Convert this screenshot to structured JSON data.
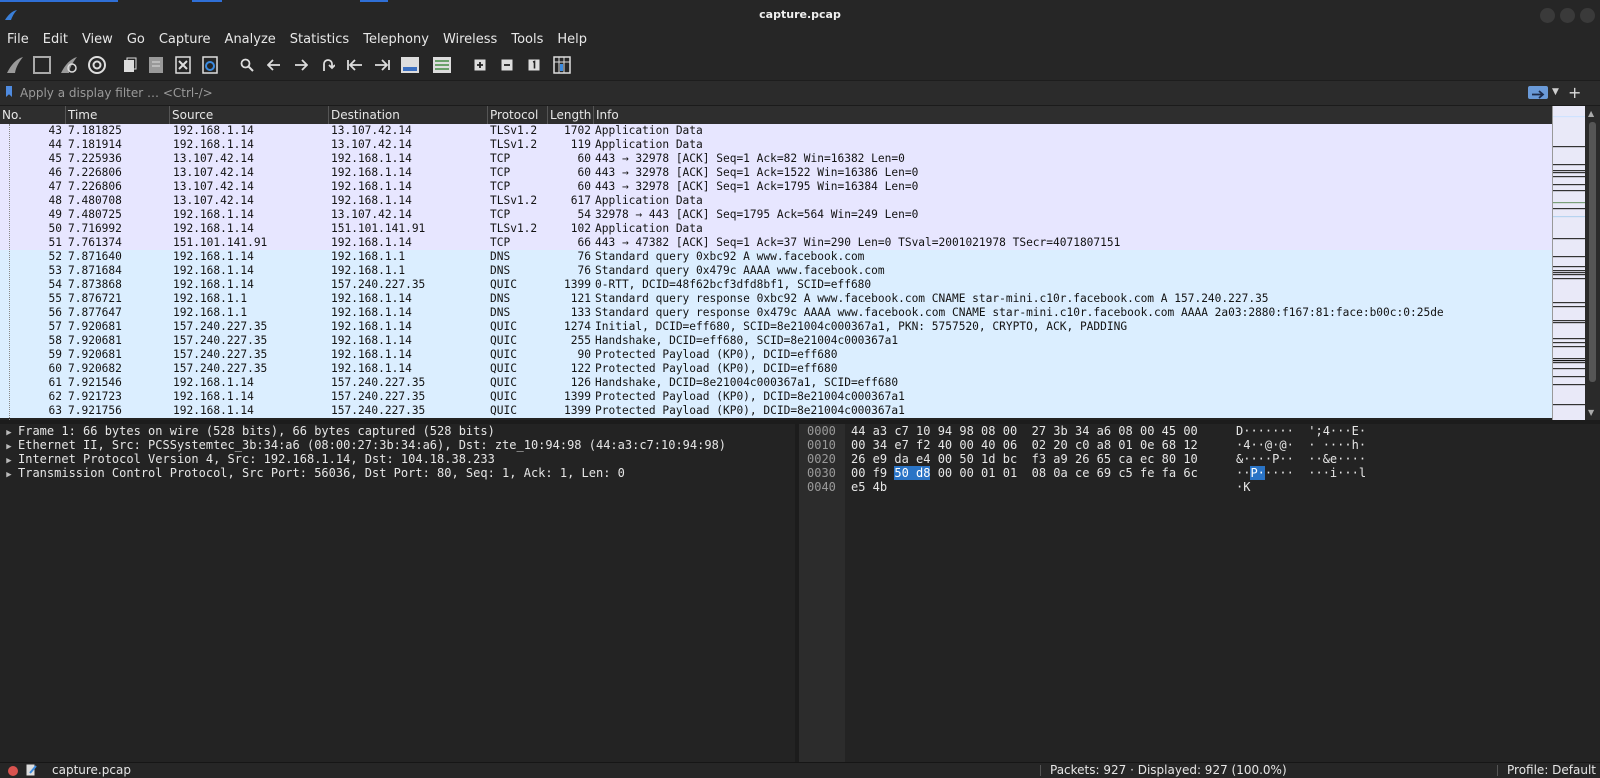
{
  "window": {
    "title": "capture.pcap"
  },
  "menu": [
    "File",
    "Edit",
    "View",
    "Go",
    "Capture",
    "Analyze",
    "Statistics",
    "Telephony",
    "Wireless",
    "Tools",
    "Help"
  ],
  "toolbar": {
    "icons": [
      "start-capture-icon",
      "stop-capture-icon",
      "restart-capture-icon",
      "capture-options-icon",
      "open-file-icon",
      "save-file-icon",
      "close-file-icon",
      "reload-file-icon",
      "find-packet-icon",
      "go-back-icon",
      "go-forward-icon",
      "go-to-packet-icon",
      "go-first-packet-icon",
      "go-last-packet-icon",
      "autoscroll-icon",
      "colorize-icon",
      "zoom-in-icon",
      "zoom-out-icon",
      "normal-size-icon",
      "resize-columns-icon"
    ]
  },
  "filter": {
    "placeholder": "Apply a display filter … <Ctrl-/>"
  },
  "columns": {
    "no": "No.",
    "time": "Time",
    "source": "Source",
    "destination": "Destination",
    "protocol": "Protocol",
    "length": "Length",
    "info": "Info"
  },
  "packets": [
    {
      "no": "43",
      "time": "7.181825",
      "src": "192.168.1.14",
      "dst": "13.107.42.14",
      "proto": "TLSv1.2",
      "len": "1702",
      "info": "Application Data",
      "kind": "tcp"
    },
    {
      "no": "44",
      "time": "7.181914",
      "src": "192.168.1.14",
      "dst": "13.107.42.14",
      "proto": "TLSv1.2",
      "len": "119",
      "info": "Application Data",
      "kind": "tcp"
    },
    {
      "no": "45",
      "time": "7.225936",
      "src": "13.107.42.14",
      "dst": "192.168.1.14",
      "proto": "TCP",
      "len": "60",
      "info": "443 → 32978 [ACK] Seq=1 Ack=82 Win=16382 Len=0",
      "kind": "tcp"
    },
    {
      "no": "46",
      "time": "7.226806",
      "src": "13.107.42.14",
      "dst": "192.168.1.14",
      "proto": "TCP",
      "len": "60",
      "info": "443 → 32978 [ACK] Seq=1 Ack=1522 Win=16386 Len=0",
      "kind": "tcp"
    },
    {
      "no": "47",
      "time": "7.226806",
      "src": "13.107.42.14",
      "dst": "192.168.1.14",
      "proto": "TCP",
      "len": "60",
      "info": "443 → 32978 [ACK] Seq=1 Ack=1795 Win=16384 Len=0",
      "kind": "tcp"
    },
    {
      "no": "48",
      "time": "7.480708",
      "src": "13.107.42.14",
      "dst": "192.168.1.14",
      "proto": "TLSv1.2",
      "len": "617",
      "info": "Application Data",
      "kind": "tcp"
    },
    {
      "no": "49",
      "time": "7.480725",
      "src": "192.168.1.14",
      "dst": "13.107.42.14",
      "proto": "TCP",
      "len": "54",
      "info": "32978 → 443 [ACK] Seq=1795 Ack=564 Win=249 Len=0",
      "kind": "tcp"
    },
    {
      "no": "50",
      "time": "7.716992",
      "src": "192.168.1.14",
      "dst": "151.101.141.91",
      "proto": "TLSv1.2",
      "len": "102",
      "info": "Application Data",
      "kind": "tcp"
    },
    {
      "no": "51",
      "time": "7.761374",
      "src": "151.101.141.91",
      "dst": "192.168.1.14",
      "proto": "TCP",
      "len": "66",
      "info": "443 → 47382 [ACK] Seq=1 Ack=37 Win=290 Len=0 TSval=2001021978 TSecr=4071807151",
      "kind": "tcp"
    },
    {
      "no": "52",
      "time": "7.871640",
      "src": "192.168.1.14",
      "dst": "192.168.1.1",
      "proto": "DNS",
      "len": "76",
      "info": "Standard query 0xbc92 A www.facebook.com",
      "kind": "udp"
    },
    {
      "no": "53",
      "time": "7.871684",
      "src": "192.168.1.14",
      "dst": "192.168.1.1",
      "proto": "DNS",
      "len": "76",
      "info": "Standard query 0x479c AAAA www.facebook.com",
      "kind": "udp"
    },
    {
      "no": "54",
      "time": "7.873868",
      "src": "192.168.1.14",
      "dst": "157.240.227.35",
      "proto": "QUIC",
      "len": "1399",
      "info": "0-RTT, DCID=48f62bcf3dfd8bf1, SCID=eff680",
      "kind": "udp"
    },
    {
      "no": "55",
      "time": "7.876721",
      "src": "192.168.1.1",
      "dst": "192.168.1.14",
      "proto": "DNS",
      "len": "121",
      "info": "Standard query response 0xbc92 A www.facebook.com CNAME star-mini.c10r.facebook.com A 157.240.227.35",
      "kind": "udp"
    },
    {
      "no": "56",
      "time": "7.877647",
      "src": "192.168.1.1",
      "dst": "192.168.1.14",
      "proto": "DNS",
      "len": "133",
      "info": "Standard query response 0x479c AAAA www.facebook.com CNAME star-mini.c10r.facebook.com AAAA 2a03:2880:f167:81:face:b00c:0:25de",
      "kind": "udp"
    },
    {
      "no": "57",
      "time": "7.920681",
      "src": "157.240.227.35",
      "dst": "192.168.1.14",
      "proto": "QUIC",
      "len": "1274",
      "info": "Initial, DCID=eff680, SCID=8e21004c000367a1, PKN: 5757520, CRYPTO, ACK, PADDING",
      "kind": "udp"
    },
    {
      "no": "58",
      "time": "7.920681",
      "src": "157.240.227.35",
      "dst": "192.168.1.14",
      "proto": "QUIC",
      "len": "255",
      "info": "Handshake, DCID=eff680, SCID=8e21004c000367a1",
      "kind": "udp"
    },
    {
      "no": "59",
      "time": "7.920681",
      "src": "157.240.227.35",
      "dst": "192.168.1.14",
      "proto": "QUIC",
      "len": "90",
      "info": "Protected Payload (KP0), DCID=eff680",
      "kind": "udp"
    },
    {
      "no": "60",
      "time": "7.920682",
      "src": "157.240.227.35",
      "dst": "192.168.1.14",
      "proto": "QUIC",
      "len": "122",
      "info": "Protected Payload (KP0), DCID=eff680",
      "kind": "udp"
    },
    {
      "no": "61",
      "time": "7.921546",
      "src": "192.168.1.14",
      "dst": "157.240.227.35",
      "proto": "QUIC",
      "len": "126",
      "info": "Handshake, DCID=8e21004c000367a1, SCID=eff680",
      "kind": "udp"
    },
    {
      "no": "62",
      "time": "7.921723",
      "src": "192.168.1.14",
      "dst": "157.240.227.35",
      "proto": "QUIC",
      "len": "1399",
      "info": "Protected Payload (KP0), DCID=8e21004c000367a1",
      "kind": "udp"
    },
    {
      "no": "63",
      "time": "7.921756",
      "src": "192.168.1.14",
      "dst": "157.240.227.35",
      "proto": "QUIC",
      "len": "1399",
      "info": "Protected Payload (KP0), DCID=8e21004c000367a1",
      "kind": "udp"
    }
  ],
  "details": [
    "Frame 1: 66 bytes on wire (528 bits), 66 bytes captured (528 bits)",
    "Ethernet II, Src: PCSSystemtec_3b:34:a6 (08:00:27:3b:34:a6), Dst: zte_10:94:98 (44:a3:c7:10:94:98)",
    "Internet Protocol Version 4, Src: 192.168.1.14, Dst: 104.18.38.233",
    "Transmission Control Protocol, Src Port: 56036, Dst Port: 80, Seq: 1, Ack: 1, Len: 0"
  ],
  "bytes": [
    {
      "offset": "0000",
      "pre": "44 a3 c7 10 94 98 08 00  27 3b 34 a6 08 00 45 00",
      "hl": "",
      "post": "",
      "ascii_pre": "D·······  ';4···E·",
      "ascii_hl": "",
      "ascii_post": ""
    },
    {
      "offset": "0010",
      "pre": "00 34 e7 f2 40 00 40 06  02 20 c0 a8 01 0e 68 12",
      "hl": "",
      "post": "",
      "ascii_pre": "·4··@·@·  · ····h·",
      "ascii_hl": "",
      "ascii_post": ""
    },
    {
      "offset": "0020",
      "pre": "26 e9 da e4 00 50 1d bc  f3 a9 26 65 ca ec 80 10",
      "hl": "",
      "post": "",
      "ascii_pre": "&····P··  ··&e····",
      "ascii_hl": "",
      "ascii_post": ""
    },
    {
      "offset": "0030",
      "pre": "00 f9 ",
      "hl": "50 d8",
      "post": " 00 00 01 01  08 0a ce 69 c5 fe fa 6c",
      "ascii_pre": "··",
      "ascii_hl": "P·",
      "ascii_post": "····  ···i···l"
    },
    {
      "offset": "0040",
      "pre": "e5 4b",
      "hl": "",
      "post": "",
      "ascii_pre": "·K",
      "ascii_hl": "",
      "ascii_post": ""
    }
  ],
  "status": {
    "file": "capture.pcap",
    "packets": "Packets: 927 · Displayed: 927 (100.0%)",
    "profile": "Profile: Default"
  }
}
